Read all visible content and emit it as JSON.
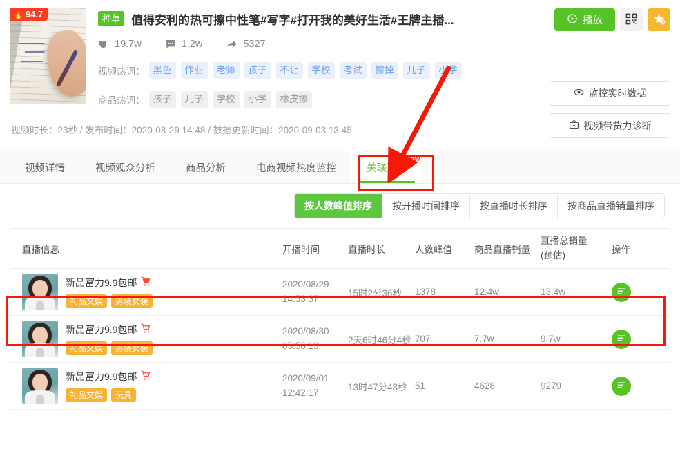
{
  "header": {
    "hot_score": "94.7",
    "hot_icon": "flame-icon",
    "category_tag": "种草",
    "title": "值得安利的热可擦中性笔#写字#打开我的美好生活#王牌主播...",
    "stats": [
      {
        "icon": "heart-icon",
        "value": "19.7w"
      },
      {
        "icon": "comment-icon",
        "value": "1.2w"
      },
      {
        "icon": "share-icon",
        "value": "5327"
      }
    ],
    "video_keywords_label": "视频热词：",
    "video_keywords": [
      "黑色",
      "作业",
      "老师",
      "孩子",
      "不让",
      "学校",
      "考试",
      "擦掉",
      "儿子",
      "小学"
    ],
    "product_keywords_label": "商品热词：",
    "product_keywords": [
      "孩子",
      "儿子",
      "学校",
      "小学",
      "橡皮擦"
    ],
    "meta": "视频时长：23秒 / 发布时间：2020-08-29 14:48 / 数据更新时间：2020-09-03 13:45",
    "play_button": "播放",
    "qr_button_icon": "qrcode-icon",
    "star_button_icon": "star-add-icon",
    "side_buttons": [
      {
        "icon": "eye-icon",
        "label": "监控实时数据"
      },
      {
        "icon": "briefcase-icon",
        "label": "视频带货力诊断"
      }
    ]
  },
  "tabs": [
    {
      "label": "视频详情",
      "active": false,
      "badge": ""
    },
    {
      "label": "视频观众分析",
      "active": false,
      "badge": ""
    },
    {
      "label": "商品分析",
      "active": false,
      "badge": ""
    },
    {
      "label": "电商视频热度监控",
      "active": false,
      "badge": ""
    },
    {
      "label": "关联直播",
      "active": true,
      "badge": "NEW"
    }
  ],
  "sort_buttons": [
    {
      "label": "按人数峰值排序",
      "active": true
    },
    {
      "label": "按开播时间排序",
      "active": false
    },
    {
      "label": "按直播时长排序",
      "active": false
    },
    {
      "label": "按商品直播销量排序",
      "active": false
    }
  ],
  "table": {
    "columns": {
      "info": "直播信息",
      "start_time": "开播时间",
      "duration": "直播时长",
      "peak": "人数峰值",
      "product_sales": "商品直播销量",
      "total_sales_line1": "直播总销量",
      "total_sales_line2": "(预估)",
      "action": "操作"
    },
    "rows": [
      {
        "avatar": "anchor-avatar",
        "room_name": "新品富力9.9包邮",
        "cart_icon": "cart-icon",
        "tags": [
          "礼品文娱",
          "男装女装"
        ],
        "start_date": "2020/08/29",
        "start_clock": "14:53:37",
        "duration": "15时2分36秒",
        "peak": "1378",
        "product_sales": "12.4w",
        "total_sales": "13.4w",
        "action_icon": "detail-list-icon"
      },
      {
        "avatar": "anchor-avatar",
        "room_name": "新品富力9.9包邮",
        "cart_icon": "cart-icon",
        "tags": [
          "礼品文娱",
          "男装女装"
        ],
        "start_date": "2020/08/30",
        "start_clock": "05:56:13",
        "duration": "2天6时46分4秒",
        "peak": "707",
        "product_sales": "7.7w",
        "total_sales": "9.7w",
        "action_icon": "detail-list-icon"
      },
      {
        "avatar": "anchor-avatar",
        "room_name": "新品富力9.9包邮",
        "cart_icon": "cart-icon",
        "tags": [
          "礼品文娱",
          "玩具"
        ],
        "start_date": "2020/09/01",
        "start_clock": "12:42:17",
        "duration": "13时47分43秒",
        "peak": "51",
        "product_sales": "4628",
        "total_sales": "9279",
        "action_icon": "detail-list-icon"
      }
    ]
  },
  "annotations": {
    "arrow_color": "#f31a08",
    "box_color": "#f31a08",
    "arrow_name": "red-pointer-arrow",
    "tab_highlight_name": "tab-highlight-box",
    "row_highlight_name": "row-highlight-box"
  },
  "colors": {
    "brand_green": "#56c426",
    "accent_orange": "#f9b233",
    "hot_red": "#ff3b1e",
    "tag_blue_bg": "#eaf1fd",
    "tag_blue_text": "#6aa0ea"
  }
}
